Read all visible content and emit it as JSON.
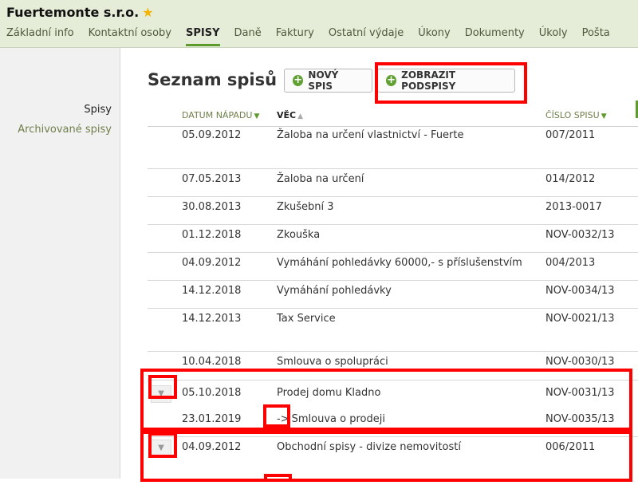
{
  "header": {
    "company": "Fuertemonte s.r.o.",
    "star_icon": "star-icon",
    "tabs": [
      {
        "label": "Základní info"
      },
      {
        "label": "Kontaktní osoby"
      },
      {
        "label": "SPISY",
        "active": true
      },
      {
        "label": "Daně"
      },
      {
        "label": "Faktury"
      },
      {
        "label": "Ostatní výdaje"
      },
      {
        "label": "Úkony"
      },
      {
        "label": "Dokumenty"
      },
      {
        "label": "Úkoly"
      },
      {
        "label": "Pošta"
      }
    ]
  },
  "sidebar": {
    "items": [
      {
        "label": "Spisy",
        "active": true
      },
      {
        "label": "Archivované spisy"
      }
    ]
  },
  "main": {
    "title": "Seznam spisů",
    "new_button": "NOVÝ SPIS",
    "subspisy_button": "ZOBRAZIT PODSPISY"
  },
  "table": {
    "columns": {
      "date": "DATUM NÁPADU",
      "vec": "VĚC",
      "number": "ČÍSLO SPISU"
    },
    "rows": [
      {
        "date": "05.09.2012",
        "vec": "Žaloba na určení vlastnictví - Fuerte",
        "number": "007/2011"
      },
      {
        "date": "07.05.2013",
        "vec": "Žaloba na určení",
        "number": "014/2012"
      },
      {
        "date": "30.08.2013",
        "vec": "Zkušební 3",
        "number": "2013-0017"
      },
      {
        "date": "01.12.2018",
        "vec": "Zkouška",
        "number": "NOV-0032/13"
      },
      {
        "date": "04.09.2012",
        "vec": "Vymáhání pohledávky 60000,- s příslušenstvím",
        "number": "004/2013"
      },
      {
        "date": "14.12.2018",
        "vec": "Vymáhání pohledávky",
        "number": "NOV-0034/13"
      },
      {
        "date": "14.12.2013",
        "vec": "Tax Service",
        "number": "NOV-0021/13"
      },
      {
        "date": "10.04.2018",
        "vec": "Smlouva o spolupráci",
        "number": "NOV-0030/13"
      },
      {
        "date": "05.10.2018",
        "vec": "Prodej domu Kladno",
        "number": "NOV-0031/13"
      },
      {
        "date": "23.01.2019",
        "arrow": "->",
        "vec": "Smlouva o prodeji",
        "number": "NOV-0035/13"
      },
      {
        "date": "04.09.2012",
        "vec": "Obchodní spisy - divize nemovitostí",
        "number": "006/2011"
      }
    ]
  },
  "colors": {
    "header_bg": "#e5ecd8",
    "accent_green": "#5f9a2c",
    "highlight_red": "#ff0000"
  }
}
